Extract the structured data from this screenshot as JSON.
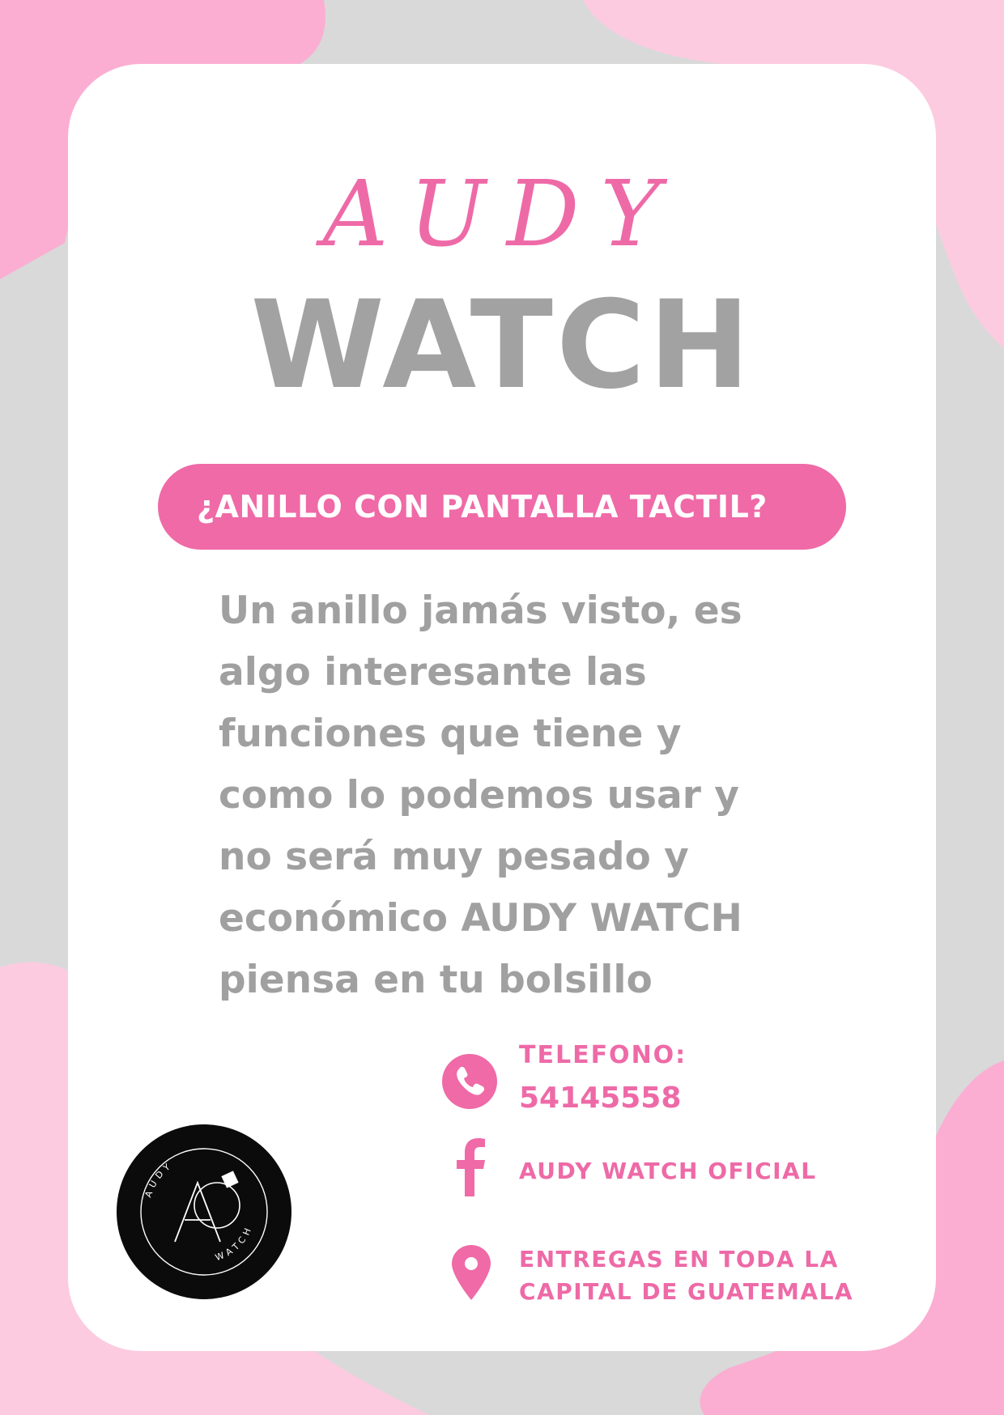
{
  "brand": {
    "script_name": "AUDY",
    "bold_name": "WATCH"
  },
  "headline": "¿ANILLO CON PANTALLA TACTIL?",
  "description_lines": [
    "Un anillo jamás visto, es",
    "algo interesante las",
    "funciones que tiene y",
    "como lo podemos usar y",
    "no será muy pesado y",
    "económico AUDY WATCH",
    "piensa en tu bolsillo"
  ],
  "contact": {
    "phone_label": "TELEFONO:",
    "phone_number": "54145558",
    "facebook": "AUDY WATCH OFICIAL",
    "delivery_line1": "ENTREGAS EN TODA LA",
    "delivery_line2": "CAPITAL DE GUATEMALA"
  },
  "logo": {
    "top_text": "AUDY",
    "bottom_text": "WATCH",
    "monogram": "A"
  },
  "icons": [
    "phone-icon",
    "facebook-icon",
    "location-pin-icon"
  ],
  "colors": {
    "accent_pink": "#ef6aa7",
    "light_pink": "#fcc8dc",
    "gray_text": "#a0a0a0",
    "background_gray": "#d9d9d9"
  }
}
